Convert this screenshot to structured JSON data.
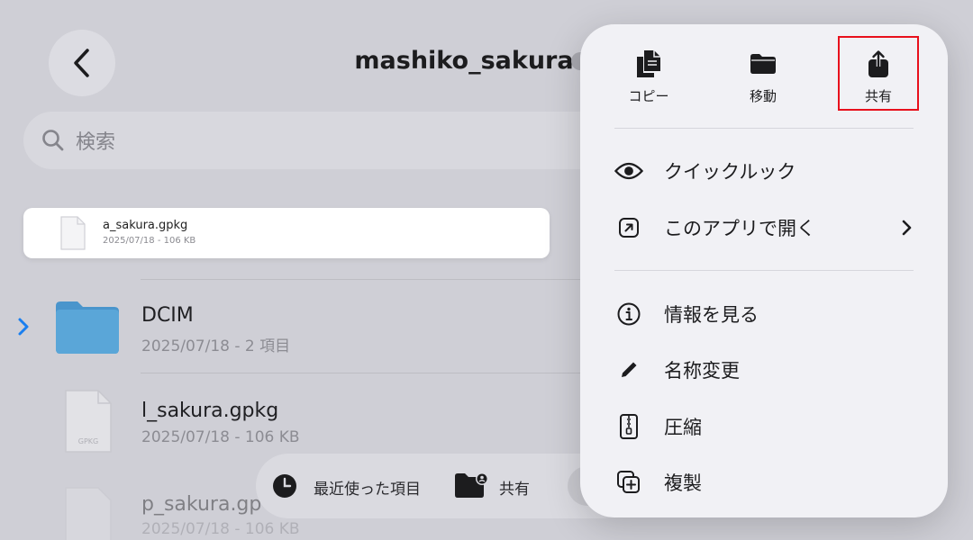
{
  "header": {
    "title": "mashiko_sakura"
  },
  "search": {
    "placeholder": "検索"
  },
  "preview": {
    "name": "a_sakura.gpkg",
    "meta": "2025/07/18 - 106 KB"
  },
  "files": [
    {
      "name": "DCIM",
      "meta": "2025/07/18 - 2 項目"
    },
    {
      "name": "l_sakura.gpkg",
      "meta": "2025/07/18 - 106 KB",
      "icon_label": "GPKG"
    },
    {
      "name": "p_sakura.gp",
      "meta": "2025/07/18 - 106 KB"
    }
  ],
  "tabbar": {
    "recent": "最近使った項目",
    "shared": "共有"
  },
  "menu": {
    "quick_actions": [
      {
        "label": "コピー",
        "icon": "copy-icon"
      },
      {
        "label": "移動",
        "icon": "folder-icon"
      },
      {
        "label": "共有",
        "icon": "share-icon"
      }
    ],
    "items": [
      {
        "label": "クイックルック",
        "icon": "eye-icon"
      },
      {
        "label": "このアプリで開く",
        "icon": "open-in-app-icon"
      },
      {
        "label": "情報を見る",
        "icon": "info-icon"
      },
      {
        "label": "名称変更",
        "icon": "pencil-icon"
      },
      {
        "label": "圧縮",
        "icon": "zip-icon"
      },
      {
        "label": "複製",
        "icon": "duplicate-icon"
      }
    ]
  },
  "colors": {
    "accent": "#1a7ff0",
    "highlight": "#e8101c",
    "folder": "#5aa6d8"
  }
}
